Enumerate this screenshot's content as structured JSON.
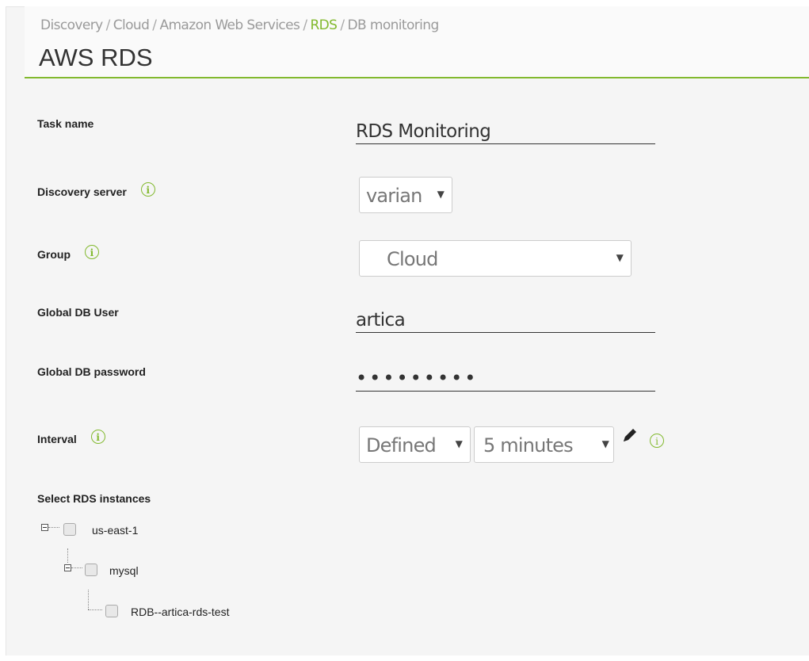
{
  "breadcrumb": {
    "items": [
      "Discovery",
      "Cloud",
      "Amazon Web Services",
      "RDS",
      "DB monitoring"
    ],
    "separator": "/"
  },
  "page_title": "AWS RDS",
  "form": {
    "task_name": {
      "label": "Task name",
      "value": "RDS Monitoring"
    },
    "discovery_server": {
      "label": "Discovery server",
      "value": "varian"
    },
    "group": {
      "label": "Group",
      "value": "Cloud"
    },
    "global_db_user": {
      "label": "Global DB User",
      "value": "artica"
    },
    "global_db_password": {
      "label": "Global DB password",
      "value": "•••••••••"
    },
    "interval": {
      "label": "Interval",
      "mode": "Defined",
      "value": "5 minutes"
    },
    "select_rds": {
      "label": "Select RDS instances"
    }
  },
  "tree": {
    "region": "us-east-1",
    "engine": "mysql",
    "instance": "RDB--artica-rds-test"
  },
  "icons": {
    "info": "info-icon",
    "edit": "pencil-icon",
    "collapse": "minus-toggle-icon",
    "dropdown": "chevron-down-icon"
  },
  "colors": {
    "accent": "#82b92e"
  }
}
